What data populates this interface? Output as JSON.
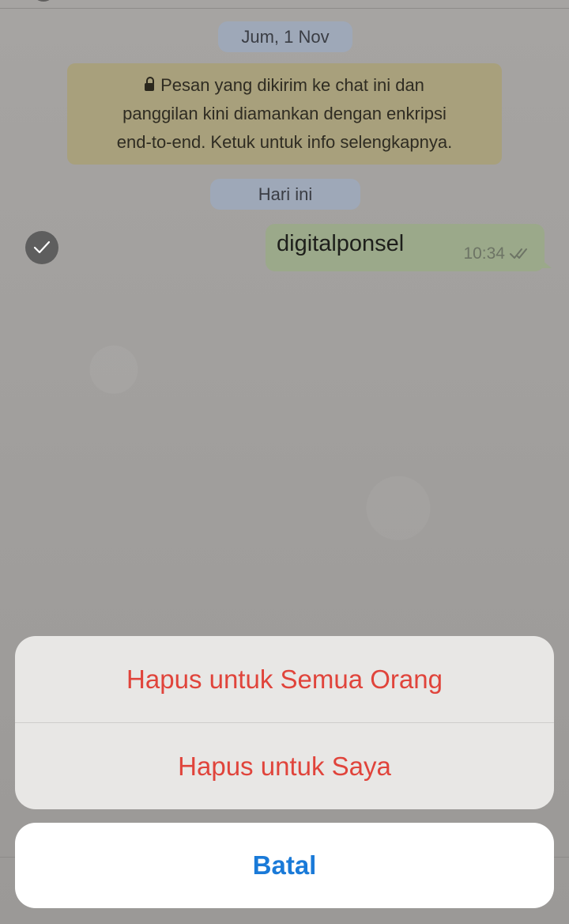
{
  "chat": {
    "date_label": "Jum, 1 Nov",
    "encryption_notice": {
      "lines": [
        "Pesan yang dikirim ke chat ini dan",
        "panggilan kini diamankan dengan enkripsi",
        "end-to-end. Ketuk untuk info selengkapnya."
      ],
      "icon": "lock-icon"
    },
    "today_label": "Hari ini",
    "message": {
      "text": "digitalponsel",
      "time": "10:34",
      "status_icon": "double-check-icon",
      "selected": true
    }
  },
  "action_sheet": {
    "items": [
      {
        "label": "Hapus untuk Semua Orang"
      },
      {
        "label": "Hapus untuk Saya"
      }
    ],
    "cancel_label": "Batal"
  },
  "colors": {
    "destructive": "#e0443b",
    "cancel": "#1a7ad8",
    "outgoing_bubble": "#9ba98a",
    "notice_bg": "#a8a07c"
  }
}
